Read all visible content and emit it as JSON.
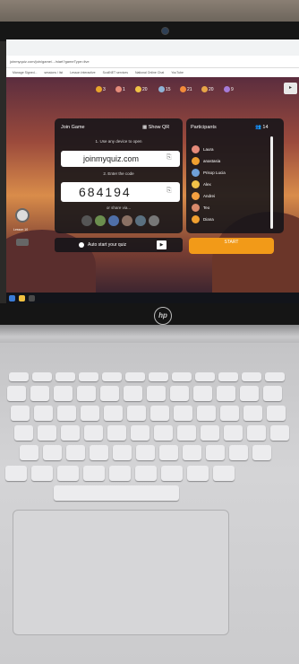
{
  "browser": {
    "url": "joinmyquiz.com/join/game/.../start?gameType=live",
    "bookmarks": [
      "Manage Signed...",
      "sessions / list",
      "Lesson Interactive",
      "ScoilNET services",
      "National Online Chat",
      "YouTube"
    ]
  },
  "topbar": {
    "items": [
      {
        "value": "3",
        "color": "#e9a52a"
      },
      {
        "value": "1",
        "color": "#e58b7a"
      },
      {
        "value": "20",
        "color": "#f0c245"
      },
      {
        "value": "15",
        "color": "#8fb3d6"
      },
      {
        "value": "21",
        "color": "#f38b3a"
      },
      {
        "value": "20",
        "color": "#e7a547"
      },
      {
        "value": "9",
        "color": "#a57bd8"
      }
    ]
  },
  "side": {
    "label": "Lesson 10"
  },
  "join": {
    "title": "Join Game",
    "show_qr": "Show QR",
    "step1": "1. Use any device to open",
    "url": "joinmyquiz.com",
    "step2": "2. Enter the code",
    "code": "684194",
    "share": "or share via..."
  },
  "participants": {
    "title": "Participants",
    "count": "14",
    "list": [
      {
        "name": "Laura",
        "color": "#e58b7a"
      },
      {
        "name": "anastasia",
        "color": "#f0a030"
      },
      {
        "name": "Prisop Lucia",
        "color": "#6fa0d8"
      },
      {
        "name": "Alex",
        "color": "#f2c248"
      },
      {
        "name": "Andrei",
        "color": "#f5a040"
      },
      {
        "name": "Teo",
        "color": "#d98a6b"
      },
      {
        "name": "Diana",
        "color": "#f0a030"
      }
    ]
  },
  "auto_start": {
    "label": "Auto start your quiz"
  },
  "start": {
    "label": "START"
  },
  "laptop": {
    "brand": "hp"
  }
}
